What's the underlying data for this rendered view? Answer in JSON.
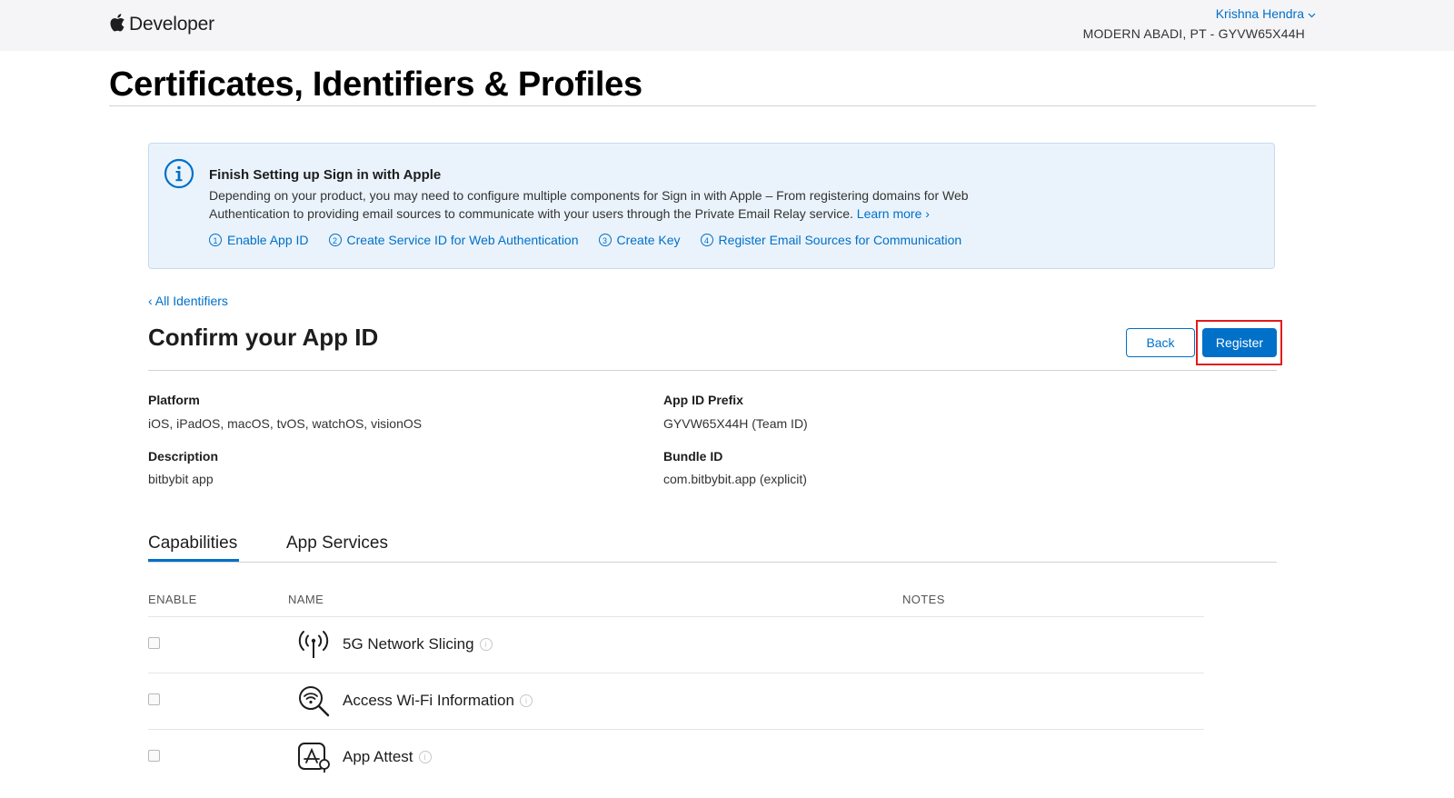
{
  "header": {
    "brand": "Developer",
    "user_name": "Krishna Hendra",
    "team": "MODERN ABADI, PT - GYVW65X44H"
  },
  "page_title": "Certificates, Identifiers & Profiles",
  "banner": {
    "title": "Finish Setting up Sign in with Apple",
    "body": "Depending on your product, you may need to configure multiple components for Sign in with Apple – From registering domains for Web Authentication to providing email sources to communicate with your users through the Private Email Relay service.",
    "learn_more": "Learn more ›",
    "steps": [
      {
        "num": "1",
        "label": "Enable App ID"
      },
      {
        "num": "2",
        "label": "Create Service ID for Web Authentication"
      },
      {
        "num": "3",
        "label": "Create Key"
      },
      {
        "num": "4",
        "label": "Register Email Sources for Communication"
      }
    ]
  },
  "back_link": "‹ All Identifiers",
  "section_title": "Confirm your App ID",
  "buttons": {
    "back": "Back",
    "register": "Register"
  },
  "details": {
    "platform_label": "Platform",
    "platform_value": "iOS, iPadOS, macOS, tvOS, watchOS, visionOS",
    "prefix_label": "App ID Prefix",
    "prefix_value": "GYVW65X44H (Team ID)",
    "description_label": "Description",
    "description_value": "bitbybit app",
    "bundle_label": "Bundle ID",
    "bundle_value": "com.bitbybit.app (explicit)"
  },
  "tabs": [
    {
      "label": "Capabilities",
      "active": true
    },
    {
      "label": "App Services",
      "active": false
    }
  ],
  "table": {
    "columns": {
      "enable": "ENABLE",
      "name": "NAME",
      "notes": "NOTES"
    },
    "rows": [
      {
        "name": "5G Network Slicing",
        "icon": "antenna-icon",
        "enabled": false
      },
      {
        "name": "Access Wi-Fi Information",
        "icon": "wifi-search-icon",
        "enabled": false
      },
      {
        "name": "App Attest",
        "icon": "app-attest-icon",
        "enabled": false
      }
    ]
  },
  "colors": {
    "accent": "#0070c9",
    "highlight": "#e21b1b",
    "banner_bg": "#eaf3fb"
  }
}
